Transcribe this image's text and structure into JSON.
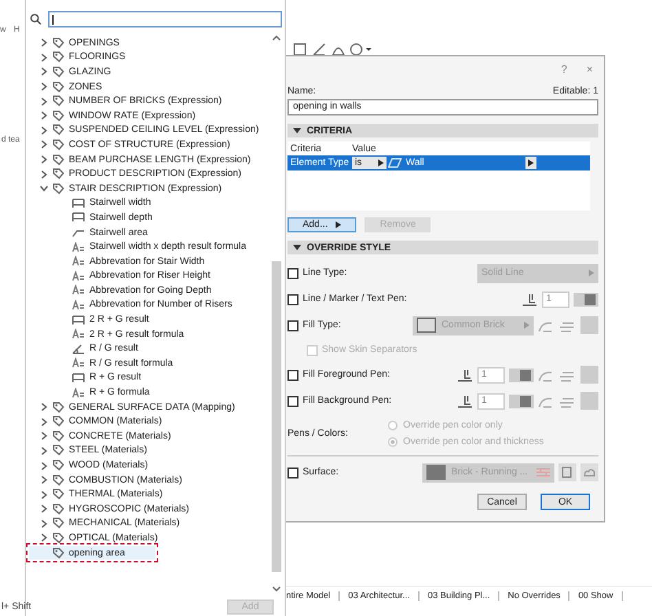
{
  "background_texts": [
    "w",
    "H",
    "d tea"
  ],
  "finder": {
    "tree": [
      {
        "label": "OPENINGS",
        "expanded": false,
        "selected": false
      },
      {
        "label": "FLOORINGS",
        "expanded": false,
        "selected": false
      },
      {
        "label": "GLAZING",
        "expanded": false,
        "selected": false
      },
      {
        "label": "ZONES",
        "expanded": false,
        "selected": false
      },
      {
        "label": "NUMBER OF BRICKS (Expression)",
        "expanded": false,
        "selected": false
      },
      {
        "label": "WINDOW RATE (Expression)",
        "expanded": false,
        "selected": false
      },
      {
        "label": "SUSPENDED CEILING LEVEL (Expression)",
        "expanded": false,
        "selected": false
      },
      {
        "label": "COST OF STRUCTURE (Expression)",
        "expanded": false,
        "selected": false
      },
      {
        "label": "BEAM PURCHASE LENGTH (Expression)",
        "expanded": false,
        "selected": false
      },
      {
        "label": "PRODUCT DESCRIPTION (Expression)",
        "expanded": false,
        "selected": false
      },
      {
        "label": "STAIR DESCRIPTION (Expression)",
        "expanded": true,
        "selected": false,
        "children": [
          {
            "label": "Stairwell width",
            "kind": "length",
            "selected": false
          },
          {
            "label": "Stairwell depth",
            "kind": "length",
            "selected": false
          },
          {
            "label": "Stairwell area",
            "kind": "area",
            "selected": false
          },
          {
            "label": "Stairwell width x depth result formula",
            "kind": "text",
            "selected": false
          },
          {
            "label": "Abbrevation for Stair Width",
            "kind": "text",
            "selected": false
          },
          {
            "label": "Abbrevation for Riser Height",
            "kind": "text",
            "selected": false
          },
          {
            "label": "Abbrevation for Going Depth",
            "kind": "text",
            "selected": false
          },
          {
            "label": "Abbrevation for Number of Risers",
            "kind": "text",
            "selected": false
          },
          {
            "label": "2 R + G result",
            "kind": "length",
            "selected": false
          },
          {
            "label": "2 R + G result formula",
            "kind": "text",
            "selected": false
          },
          {
            "label": "R / G result",
            "kind": "angle",
            "selected": false
          },
          {
            "label": "R / G result formula",
            "kind": "text",
            "selected": false
          },
          {
            "label": "R + G result",
            "kind": "length",
            "selected": false
          },
          {
            "label": "R + G formula",
            "kind": "text",
            "selected": false
          }
        ]
      },
      {
        "label": "GENERAL SURFACE DATA (Mapping)",
        "expanded": false,
        "selected": false
      },
      {
        "label": "COMMON (Materials)",
        "expanded": false,
        "selected": false
      },
      {
        "label": "CONCRETE (Materials)",
        "expanded": false,
        "selected": false
      },
      {
        "label": "STEEL (Materials)",
        "expanded": false,
        "selected": false
      },
      {
        "label": "WOOD (Materials)",
        "expanded": false,
        "selected": false
      },
      {
        "label": "COMBUSTION (Materials)",
        "expanded": false,
        "selected": false
      },
      {
        "label": "THERMAL (Materials)",
        "expanded": false,
        "selected": false
      },
      {
        "label": "HYGROSCOPIC (Materials)",
        "expanded": false,
        "selected": false
      },
      {
        "label": "MECHANICAL (Materials)",
        "expanded": false,
        "selected": false
      },
      {
        "label": "OPTICAL (Materials)",
        "expanded": false,
        "selected": false
      },
      {
        "label": "opening area",
        "selected": true
      }
    ],
    "add_button": {
      "label": "Add",
      "disabled": true
    }
  },
  "shortcut_text": "l+ Shift",
  "dialog": {
    "help": "?",
    "close": "×",
    "name_label": "Name:",
    "editable": "Editable: 1",
    "name_value": "opening in walls",
    "criteria": {
      "title": "CRITERIA",
      "expanded": true,
      "columns": [
        "Criteria",
        "Value"
      ],
      "rows": [
        {
          "criteria": "Element Type",
          "operator": "is",
          "value": "Wall",
          "selected": true
        }
      ],
      "add_button": {
        "label": "Add...",
        "disabled": false
      },
      "remove_button": {
        "label": "Remove",
        "disabled": true
      }
    },
    "override": {
      "title": "OVERRIDE STYLE",
      "expanded": true,
      "options": [
        {
          "kind": "dropdown",
          "label": "Line Type:",
          "checked": false,
          "value": "Solid Line",
          "swatch": false,
          "extras": false
        },
        {
          "kind": "pen",
          "label": "Line / Marker / Text Pen:",
          "checked": false,
          "value": "1",
          "extras": false
        },
        {
          "kind": "dropdown",
          "label": "Fill Type:",
          "checked": false,
          "value": "Common Brick",
          "swatch": true,
          "extras": true
        },
        {
          "kind": "subcheck",
          "label": "Show Skin Separators",
          "checked": false,
          "disabled": true
        },
        {
          "kind": "pen",
          "label": "Fill Foreground Pen:",
          "checked": false,
          "value": "1",
          "extras": true
        },
        {
          "kind": "pen",
          "label": "Fill Background Pen:",
          "checked": false,
          "value": "1",
          "extras": true
        },
        {
          "kind": "radios",
          "label": "Pens / Colors:",
          "choices": [
            {
              "label": "Override pen color only",
              "selected": false
            },
            {
              "label": "Override pen color and thickness",
              "selected": true
            }
          ]
        },
        {
          "kind": "surface",
          "label": "Surface:",
          "checked": false,
          "value": "Brick - Running ..."
        }
      ]
    },
    "buttons": [
      {
        "label": "Cancel",
        "default": false
      },
      {
        "label": "OK",
        "default": true
      }
    ]
  },
  "status_bar": [
    "ntire Model",
    "03 Architectur...",
    "03 Building Pl...",
    "No Overrides",
    "00 Show"
  ]
}
